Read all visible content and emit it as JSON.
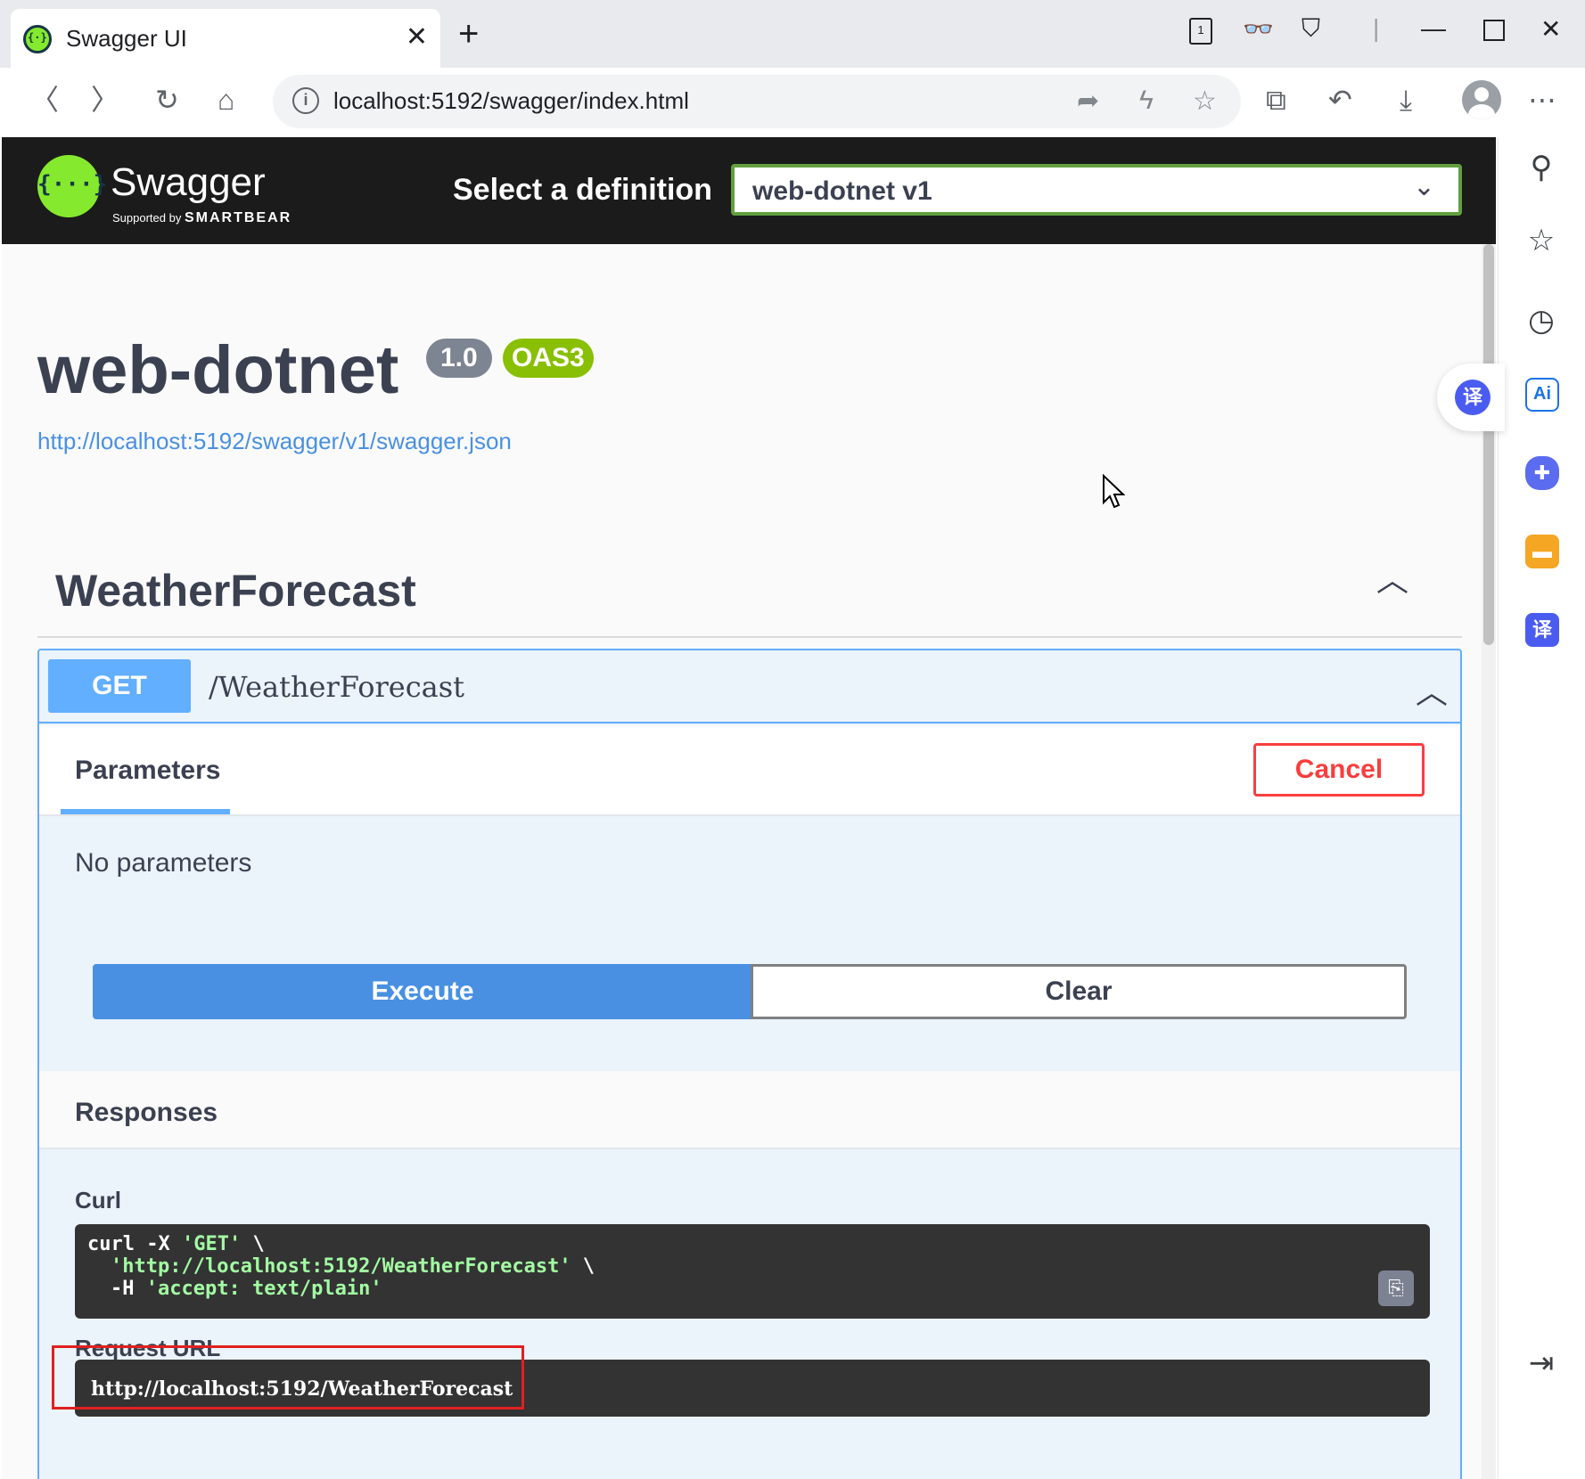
{
  "browser": {
    "tab_title": "Swagger UI",
    "address": "localhost:5192/swagger/index.html"
  },
  "swagger": {
    "brand": "Swagger",
    "supported_by": "Supported by",
    "smartbear": "SMARTBEAR",
    "select_label": "Select a definition",
    "selected_definition": "web-dotnet v1"
  },
  "api": {
    "title": "web-dotnet",
    "version": "1.0",
    "oas": "OAS3",
    "spec_url": "http://localhost:5192/swagger/v1/swagger.json"
  },
  "tag": {
    "name": "WeatherForecast"
  },
  "operation": {
    "method": "GET",
    "path": "/WeatherForecast",
    "parameters_tab": "Parameters",
    "cancel_label": "Cancel",
    "no_params": "No parameters",
    "execute_label": "Execute",
    "clear_label": "Clear",
    "responses_title": "Responses",
    "curl_label": "Curl",
    "curl": {
      "l1_cmd": "curl -X ",
      "l1_str": "'GET'",
      "l1_end": " \\",
      "l2_str": "'http://localhost:5192/WeatherForecast'",
      "l2_end": " \\",
      "l3_cmd": "-H ",
      "l3_str": "'accept: text/plain'"
    },
    "request_url_label": "Request URL",
    "request_url": "http://localhost:5192/WeatherForecast"
  },
  "colors": {
    "get": "#61affe",
    "execute": "#4990e2",
    "cancel": "#f93e3e",
    "oas": "#89bf04",
    "version": "#7d8492",
    "highlight": "#e02020"
  }
}
